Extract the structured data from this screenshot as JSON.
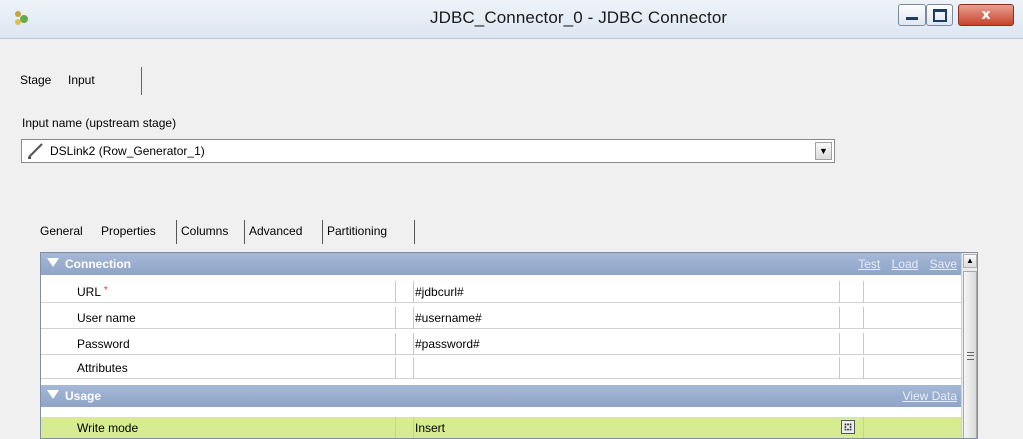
{
  "window": {
    "title": "JDBC_Connector_0 - JDBC Connector",
    "buttons": {
      "minimize": "minimize-icon",
      "maximize": "maximize-icon",
      "close": "x"
    }
  },
  "outer_tabs": [
    "Stage",
    "Input"
  ],
  "input_name": {
    "label": "Input name (upstream stage)",
    "value": "DSLink2 (Row_Generator_1)"
  },
  "inner_tabs": [
    "General",
    "Properties",
    "Columns",
    "Advanced",
    "Partitioning"
  ],
  "properties": {
    "connection": {
      "label": "Connection",
      "links": [
        "Test",
        "Load",
        "Save"
      ],
      "rows": [
        {
          "name": "URL",
          "required_mark": "*",
          "value": "#jdbcurl#"
        },
        {
          "name": "User name",
          "value": "#username#"
        },
        {
          "name": "Password",
          "value": "#password#"
        },
        {
          "name": "Attributes",
          "value": ""
        }
      ]
    },
    "usage": {
      "label": "Usage",
      "links": [
        "View Data"
      ],
      "rows": [
        {
          "name": "Write mode",
          "value": "Insert"
        }
      ]
    }
  },
  "colors": {
    "section_header": "#8ea4c8",
    "highlight_row": "#d7ec91"
  }
}
